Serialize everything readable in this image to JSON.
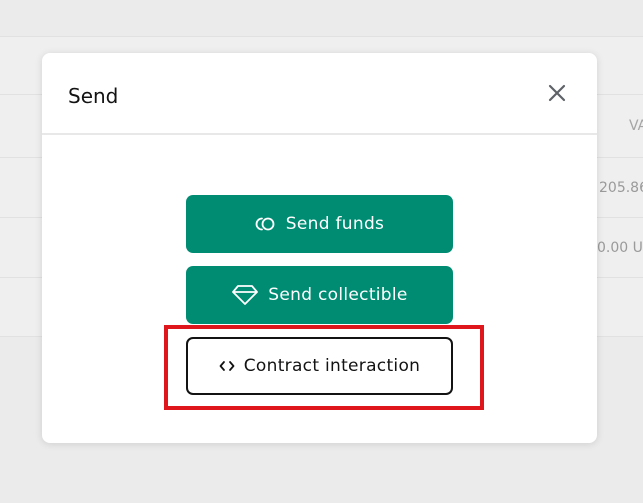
{
  "background": {
    "header_cell": "VA",
    "row_values": [
      "205.86",
      "0.00 U"
    ]
  },
  "modal": {
    "title": "Send",
    "buttons": {
      "send_funds": "Send funds",
      "send_collectible": "Send collectible",
      "contract_interaction": "Contract interaction"
    }
  },
  "colors": {
    "primary": "#008c73",
    "highlight": "#e0161d",
    "text": "#121312"
  },
  "icons": {
    "close": "close-icon",
    "send_funds": "coins-icon",
    "send_collectible": "diamond-icon",
    "contract_interaction": "code-icon"
  }
}
